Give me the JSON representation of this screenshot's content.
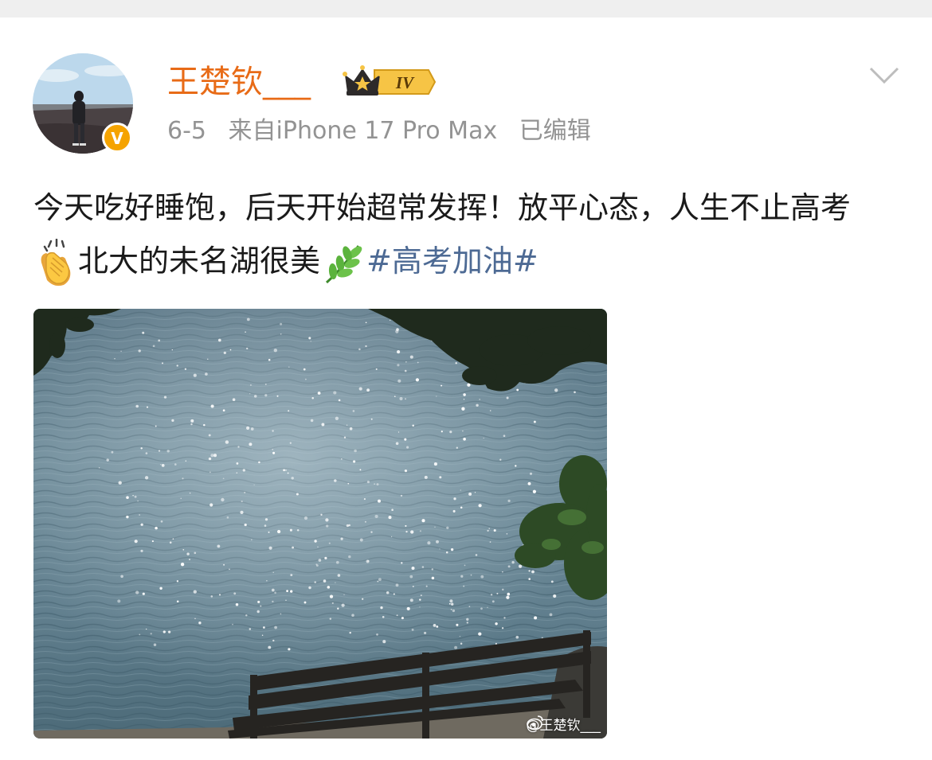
{
  "post": {
    "author": {
      "name": "王楚钦___",
      "verified_mark": "V",
      "vip_level": "IV"
    },
    "meta": {
      "date": "6-5",
      "source": "来自iPhone 17 Pro Max",
      "edited": "已编辑"
    },
    "text": {
      "line_part1": "今天吃好睡饱，后天开始超常发挥！放平心态，人生不止高考",
      "line_part2": "北大的未名湖很美",
      "hashtag": "#高考加油#",
      "emoji_1": "clapping-hands",
      "emoji_2": "herb"
    },
    "image": {
      "watermark": "@王楚钦___"
    }
  },
  "colors": {
    "username": "#e86b17",
    "meta": "#939393",
    "hashtag": "#4d6a94",
    "verified_badge": "#f5a300"
  }
}
